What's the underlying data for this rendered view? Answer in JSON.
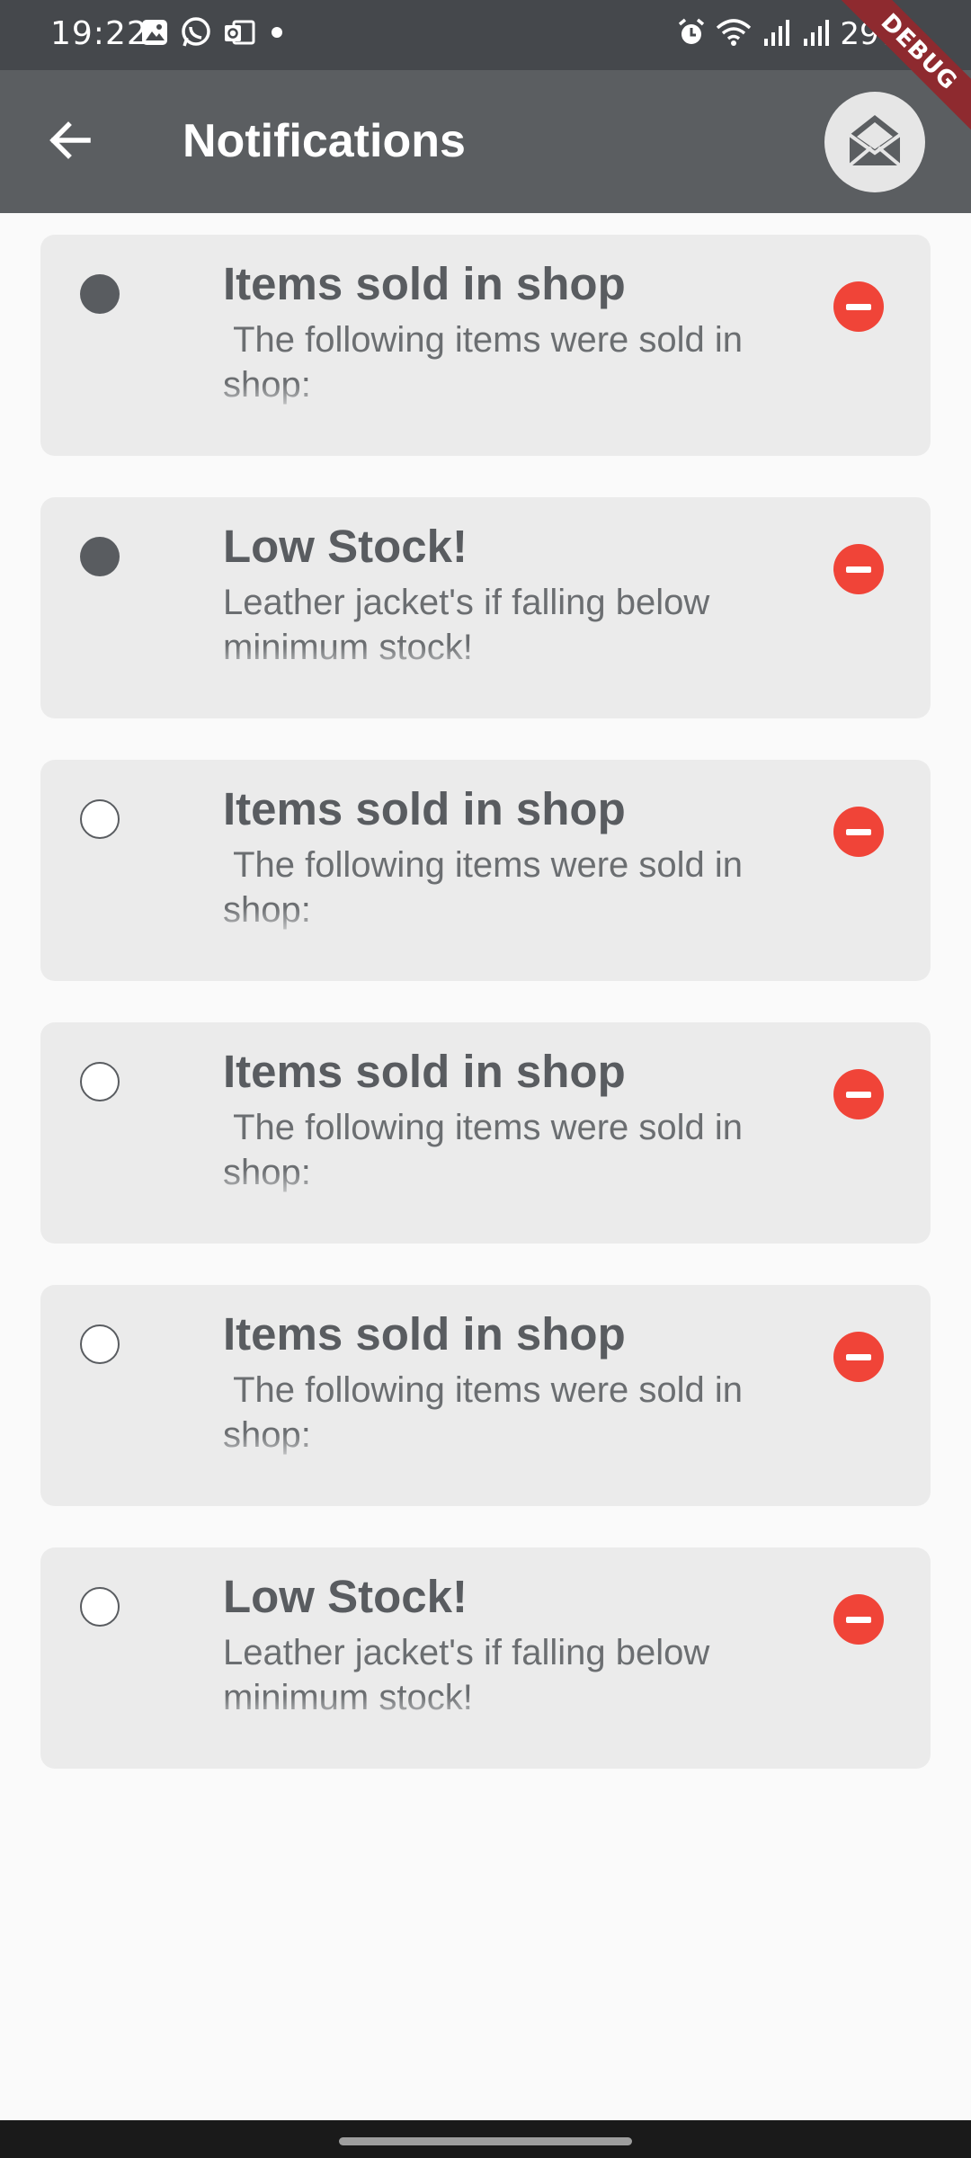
{
  "status_bar": {
    "time": "19:22",
    "battery": "29%",
    "left_icons": [
      "gallery-icon",
      "whatsapp-icon",
      "outlook-icon",
      "dot-icon"
    ],
    "right_icons": [
      "alarm-icon",
      "wifi-icon",
      "signal-icon",
      "signal-icon"
    ]
  },
  "debug_banner": "DEBUG",
  "app_bar": {
    "title": "Notifications",
    "back_icon": "arrow-left-icon",
    "action_icon": "envelope-open-icon"
  },
  "colors": {
    "app_bar": "#5b5e61",
    "status_bar": "#45484c",
    "card": "#ebebeb",
    "remove": "#f04438",
    "title_text": "#595c60"
  },
  "notifications": [
    {
      "title": "Items sold in shop",
      "body": " The following items were sold in\nshop:",
      "read": false
    },
    {
      "title": "Low Stock!",
      "body": "Leather jacket's if falling below\nminimum stock!",
      "read": false
    },
    {
      "title": "Items sold in shop",
      "body": " The following items were sold in\nshop:",
      "read": true
    },
    {
      "title": "Items sold in shop",
      "body": " The following items were sold in\nshop:",
      "read": true
    },
    {
      "title": "Items sold in shop",
      "body": " The following items were sold in\nshop:",
      "read": true
    },
    {
      "title": "Low Stock!",
      "body": "Leather jacket's if falling below\nminimum stock!",
      "read": true
    }
  ]
}
